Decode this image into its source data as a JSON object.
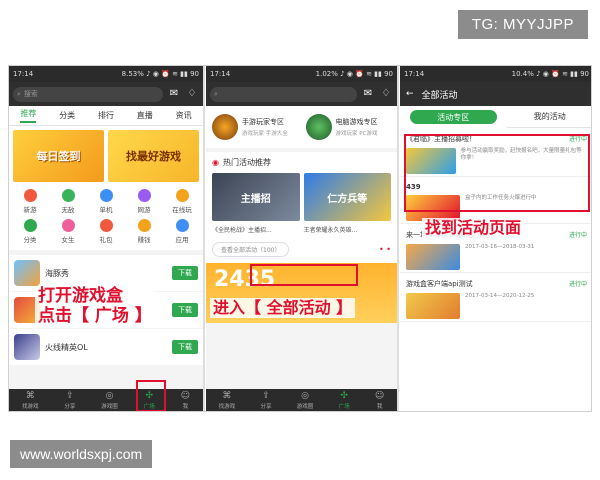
{
  "watermarks": {
    "top": "TG: MYYJJPP",
    "bottom": "www.worldsxpj.com"
  },
  "phone1": {
    "status_time": "17:14",
    "status_right": "8.53% ♪ ◉ ⏰ ≋ ▮▮ 90",
    "search_placeholder": "搜索",
    "tabs": [
      "推荐",
      "分类",
      "排行",
      "直播",
      "资讯"
    ],
    "banners": [
      "每日签到",
      "找最好游戏"
    ],
    "categories": [
      "新游",
      "无敌",
      "单机",
      "网游",
      "在线玩",
      "分类",
      "女生",
      "礼包",
      "赚钱",
      "应用"
    ],
    "category_colors": [
      "#f0593e",
      "#38b35a",
      "#3d8ef5",
      "#9a5bf0",
      "#f2a21b",
      "#2fa84f",
      "#ee5f9b",
      "#f0593e",
      "#f2a21b",
      "#3d8ef5"
    ],
    "games": [
      {
        "name": "海豚秀",
        "button": "下载"
      },
      {
        "name": "",
        "button": "下载"
      },
      {
        "name": "火线精英OL",
        "button": "下载"
      }
    ],
    "nav": [
      "找游戏",
      "分享",
      "游戏圈",
      "广场",
      "我"
    ],
    "callout": "打开游戏盒\n点击【 广场 】"
  },
  "phone2": {
    "status_time": "17:14",
    "status_right": "1.02% ♪ ◉ ⏰ ≋ ▮▮ 90",
    "zones": [
      {
        "title": "手游玩家专区",
        "sub": "游戏玩家 手游大全"
      },
      {
        "title": "电脑游戏专区",
        "sub": "游戏玩家 PC游戏"
      }
    ],
    "section_title": "热门活动推荐",
    "events": [
      {
        "image_text": "主播招",
        "caption": "《全民枪战》主播招..."
      },
      {
        "image_text": "仁方兵等",
        "caption": "王者荣耀永久英雄..."
      }
    ],
    "all_button": "查看全部活动（100）",
    "counter": "2435",
    "nav": [
      "找游戏",
      "分享",
      "游戏圈",
      "广场",
      "我"
    ],
    "callout": "进入【 全部活动 】"
  },
  "phone3": {
    "status_time": "17:14",
    "status_right": "10.4% ♪ ◉ ⏰ ≋ ▮▮ 90",
    "header_title": "全部活动",
    "tabs": [
      "活动专区",
      "我的活动"
    ],
    "activities": [
      {
        "title": "《君临》主播招募啦！",
        "status": "进行中",
        "text": "参与活动赢取奖励，赶快报名吧，大量限量礼包等你拿！"
      },
      {
        "title": "",
        "status": "",
        "text": "盒子内的工作任务火爆进行中"
      },
      {
        "title": "来一场棒棒糖满满的战斗吧！",
        "status": "进行中",
        "text": "2017-03-16—2018-03-31"
      },
      {
        "title": "游戏盒客户端api测试",
        "status": "进行中",
        "text": "2017-03-14—2020-12-25"
      }
    ],
    "counter": "439",
    "callout": "找到活动页面"
  }
}
